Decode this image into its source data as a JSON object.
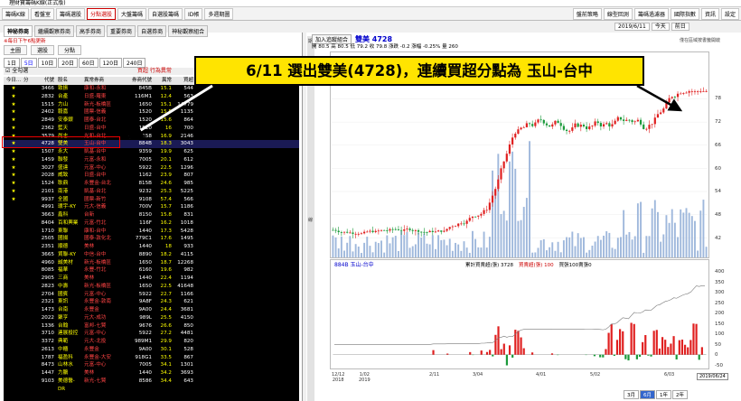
{
  "app_title": "理財寶籌碼K線(正式版)",
  "toolbar": {
    "tabs": [
      "籌碼K線",
      "看盤室",
      "籌碼選股",
      "分點選股",
      "大盤籌碼",
      "自選股籌碼",
      "ID帳",
      "多週期圖"
    ],
    "active_tab_index": 3,
    "right_buttons": [
      "盤前策略",
      "線型回測",
      "籌碼過濾器",
      "國際指數",
      "資訊",
      "設定"
    ]
  },
  "date_controls": {
    "date": "2019/6/11",
    "today_btn": "今天",
    "range_btn": "前日"
  },
  "left": {
    "tabs": [
      "神秘券商",
      "繼續觀察券商",
      "高手券商",
      "重要券商",
      "自選券商",
      "神秘觀察組合"
    ],
    "active_tab_index": 0,
    "notice": "※每日下午6點更新",
    "sub_buttons": [
      "主圖",
      "選股",
      "分點"
    ],
    "periods": [
      "1日",
      "5日",
      "10日",
      "20日",
      "60日",
      "120日",
      "240日"
    ],
    "active_period_index": 1,
    "select_bar": {
      "checkbox_label": "全勾選",
      "mode": "買超 行為異常"
    },
    "columns": [
      "今日...",
      "分",
      "代號",
      "股名",
      "異常券商",
      "券商代號",
      "異常(%)",
      "買超"
    ],
    "rows": [
      {
        "star": "★",
        "code": "3466",
        "name": "致振",
        "broker": "康和-永和",
        "bcode": "845B",
        "pct": "15.1",
        "qty": "544"
      },
      {
        "star": "★",
        "code": "2832",
        "name": "台產",
        "broker": "日盛-羅東",
        "bcode": "116M1",
        "pct": "12.4",
        "qty": "563"
      },
      {
        "star": "★",
        "code": "1515",
        "name": "力山",
        "broker": "新光-板橋區",
        "bcode": "1650",
        "pct": "15.1",
        "qty": "14779"
      },
      {
        "star": "★",
        "code": "2402",
        "name": "毅嘉",
        "broker": "國票-信義",
        "bcode": "1520",
        "pct": "15.5",
        "qty": "1135"
      },
      {
        "star": "★",
        "code": "2849",
        "name": "安泰銀",
        "broker": "國泰-台北",
        "bcode": "1520",
        "pct": "15.6",
        "qty": "864"
      },
      {
        "star": "★",
        "code": "2362",
        "name": "藍天",
        "broker": "日盛-台中",
        "bcode": "1520",
        "pct": "16",
        "qty": "700"
      },
      {
        "star": "★",
        "code": "3579",
        "name": "尚志",
        "broker": "光和-台北",
        "bcode": "1158",
        "pct": "16.9",
        "qty": "2146"
      },
      {
        "star": "★",
        "code": "4728",
        "name": "雙美",
        "broker": "玉山-台中",
        "bcode": "884B",
        "pct": "18.3",
        "qty": "3043"
      },
      {
        "star": "★",
        "code": "1507",
        "name": "永大",
        "broker": "凱基-台中",
        "bcode": "9359",
        "pct": "19.9",
        "qty": "625"
      },
      {
        "star": "★",
        "code": "1459",
        "name": "聯發",
        "broker": "元富-永和",
        "bcode": "7005",
        "pct": "20.1",
        "qty": "612"
      },
      {
        "star": "★",
        "code": "3027",
        "name": "盛達",
        "broker": "元富-中心",
        "bcode": "5922",
        "pct": "22.5",
        "qty": "1296"
      },
      {
        "star": "★",
        "code": "2028",
        "name": "威致",
        "broker": "日盛-台中",
        "bcode": "1162",
        "pct": "23.9",
        "qty": "807"
      },
      {
        "star": "★",
        "code": "1524",
        "name": "耿鼎",
        "broker": "永豐金-台北",
        "bcode": "815B",
        "pct": "24.6",
        "qty": "985"
      },
      {
        "star": "★",
        "code": "2101",
        "name": "南港",
        "broker": "凱基-台北",
        "bcode": "9232",
        "pct": "25.3",
        "qty": "5225"
      },
      {
        "star": "★",
        "code": "9937",
        "name": "全國",
        "broker": "國票-新竹",
        "bcode": "9108",
        "pct": "57.4",
        "qty": "566"
      },
      {
        "star": "",
        "code": "4991",
        "name": "環宇-KY",
        "broker": "元大-信義",
        "bcode": "700V",
        "pct": "15.7",
        "qty": "1186"
      },
      {
        "star": "",
        "code": "3663",
        "name": "鑫科",
        "broker": "台新",
        "bcode": "8150",
        "pct": "15.8",
        "qty": "831"
      },
      {
        "star": "",
        "code": "8404",
        "name": "百和興業",
        "broker": "元富-竹北",
        "bcode": "116F",
        "pct": "16.2",
        "qty": "1018"
      },
      {
        "star": "",
        "code": "1710",
        "name": "東聯",
        "broker": "康和-台中",
        "bcode": "1440",
        "pct": "17.3",
        "qty": "5428"
      },
      {
        "star": "",
        "code": "2505",
        "name": "國揚",
        "broker": "國泰-敦化北",
        "bcode": "779C1",
        "pct": "17.6",
        "qty": "1495"
      },
      {
        "star": "",
        "code": "2351",
        "name": "順德",
        "broker": "美林",
        "bcode": "1440",
        "pct": "18",
        "qty": "933"
      },
      {
        "star": "",
        "code": "3665",
        "name": "貿聯-KY",
        "broker": "中信-台中",
        "bcode": "8890",
        "pct": "18.2",
        "qty": "4115"
      },
      {
        "star": "",
        "code": "4960",
        "name": "誠美材",
        "broker": "新光-板橋區",
        "bcode": "1650",
        "pct": "18.7",
        "qty": "12268"
      },
      {
        "star": "",
        "code": "8085",
        "name": "福華",
        "broker": "永豐-竹北",
        "bcode": "6160",
        "pct": "19.6",
        "qty": "982"
      },
      {
        "star": "",
        "code": "2905",
        "name": "三商",
        "broker": "美林",
        "bcode": "1440",
        "pct": "22.4",
        "qty": "1194"
      },
      {
        "star": "",
        "code": "2823",
        "name": "中壽",
        "broker": "新光-板橋區",
        "bcode": "1650",
        "pct": "22.5",
        "qty": "41648"
      },
      {
        "star": "",
        "code": "2704",
        "name": "國賓",
        "broker": "元富-中心",
        "bcode": "5922",
        "pct": "22.7",
        "qty": "1166"
      },
      {
        "star": "",
        "code": "2321",
        "name": "東訊",
        "broker": "永豐金-敦南",
        "bcode": "9A8F",
        "pct": "24.3",
        "qty": "621"
      },
      {
        "star": "",
        "code": "1473",
        "name": "台南",
        "broker": "永豐金",
        "bcode": "9A00",
        "pct": "24.4",
        "qty": "3681"
      },
      {
        "star": "",
        "code": "2022",
        "name": "聚亨",
        "broker": "元大-成功",
        "bcode": "989L",
        "pct": "25.5",
        "qty": "4150"
      },
      {
        "star": "",
        "code": "1336",
        "name": "台翰",
        "broker": "富邦-七賢",
        "bcode": "9676",
        "pct": "26.6",
        "qty": "850"
      },
      {
        "star": "",
        "code": "3710",
        "name": "連展投控",
        "broker": "元富-中心",
        "bcode": "5922",
        "pct": "27.2",
        "qty": "4481"
      },
      {
        "star": "",
        "code": "3372",
        "name": "典範",
        "broker": "元大-北投",
        "bcode": "989M1",
        "pct": "29.9",
        "qty": "820"
      },
      {
        "star": "",
        "code": "2613",
        "name": "中櫃",
        "broker": "永豐金",
        "bcode": "9A00",
        "pct": "30.1",
        "qty": "528"
      },
      {
        "star": "",
        "code": "1787",
        "name": "福盈科",
        "broker": "永豐金-大安",
        "bcode": "918G1",
        "pct": "33.5",
        "qty": "867"
      },
      {
        "star": "",
        "code": "8473",
        "name": "山林水",
        "broker": "元富-中心",
        "bcode": "7005",
        "pct": "34.1",
        "qty": "1301"
      },
      {
        "star": "",
        "code": "1447",
        "name": "力鵬",
        "broker": "美林",
        "bcode": "1440",
        "pct": "34.2",
        "qty": "3693"
      },
      {
        "star": "",
        "code": "9103",
        "name": "美德醫-DR",
        "broker": "新光-七賢",
        "bcode": "8586",
        "pct": "34.4",
        "qty": "643"
      }
    ],
    "highlight_row_index": 7
  },
  "right": {
    "header": {
      "btn_join": "加入追蹤組合",
      "stock": "雙美 4728",
      "note": "僅在區域按書籤開啟"
    },
    "ohlc": "開 80.5  高 80.5  低 79.2  收 79.8  漲跌 -0.2  漲幅 -0.25%  量 260",
    "price_ticks": [
      "78",
      "72",
      "66",
      "60",
      "54",
      "48",
      "42"
    ],
    "volume_title": "884B 玉山-台中",
    "volume_legend": [
      "累計買賣超(張) 3728",
      "買賣超(張) 100",
      "買張100賣張0"
    ],
    "volume_ticks": [
      "400",
      "350",
      "300",
      "250",
      "200",
      "150",
      "100",
      "50",
      "0",
      "-50"
    ],
    "x_ticks": [
      {
        "top": "12/12",
        "bot": "2018"
      },
      {
        "top": "1/02",
        "bot": "2019"
      },
      {
        "top": "2/11",
        "bot": ""
      },
      {
        "top": "3/04",
        "bot": ""
      },
      {
        "top": "4/01",
        "bot": ""
      },
      {
        "top": "5/02",
        "bot": ""
      },
      {
        "top": "6/03",
        "bot": ""
      }
    ],
    "last_date": "2019/06/24",
    "bottom_buttons": [
      "3月",
      "6月",
      "1年",
      "2年"
    ],
    "active_bottom": 1,
    "side_labels": [
      "期",
      "線"
    ]
  },
  "callout": "6/11 選出雙美(4728)，連續買超分點為  玉山-台中",
  "colors": {
    "up": "#e02020",
    "down": "#1a9a3a",
    "highlight": "#e00000",
    "callout": "#ffe400"
  }
}
